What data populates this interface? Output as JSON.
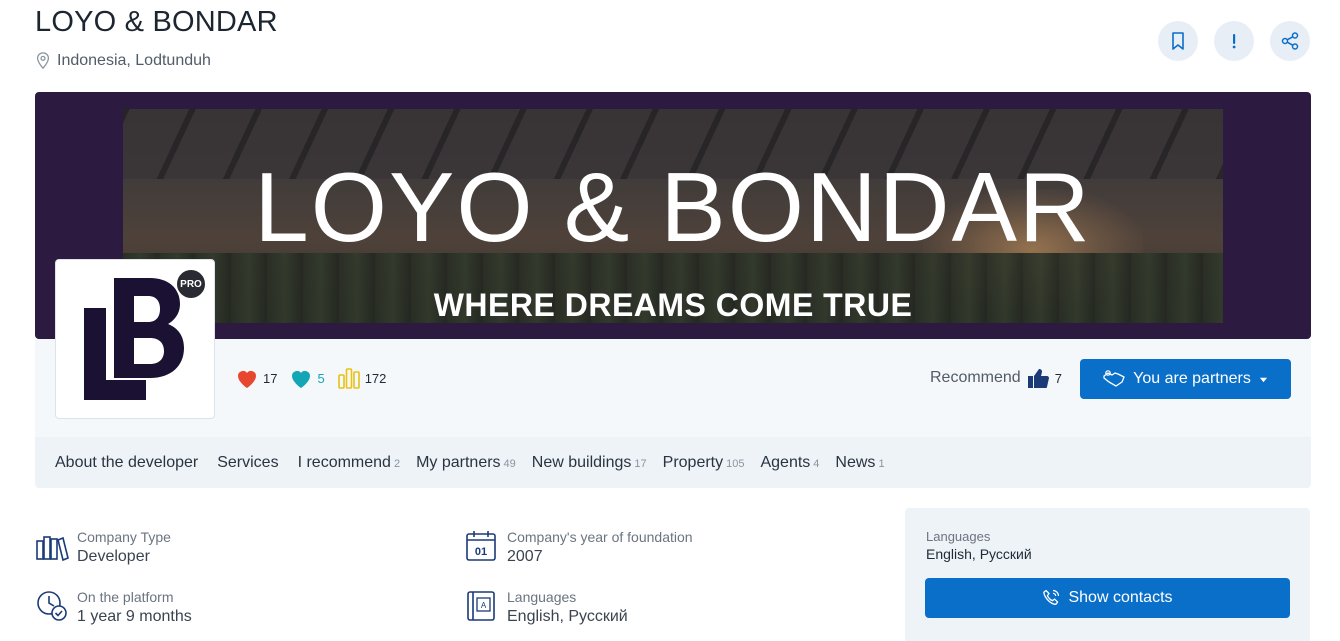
{
  "header": {
    "title": "LOYO & BONDAR",
    "location": "Indonesia, Lodtunduh"
  },
  "banner": {
    "title": "LOYO & BONDAR",
    "subtitle": "WHERE DREAMS COME TRUE"
  },
  "logo": {
    "badge": "PRO"
  },
  "stats": {
    "likes": "17",
    "favorites": "5",
    "views": "172"
  },
  "recommend": {
    "label": "Recommend",
    "count": "7"
  },
  "partners_button": "You are partners",
  "tabs": [
    {
      "label": "About the developer",
      "count": ""
    },
    {
      "label": "Services",
      "count": ""
    },
    {
      "label": "I recommend",
      "count": "2"
    },
    {
      "label": "My partners",
      "count": "49"
    },
    {
      "label": "New buildings",
      "count": "17"
    },
    {
      "label": "Property",
      "count": "105"
    },
    {
      "label": "Agents",
      "count": "4"
    },
    {
      "label": "News",
      "count": "1"
    }
  ],
  "info": {
    "company_type": {
      "label": "Company Type",
      "value": "Developer"
    },
    "foundation": {
      "label": "Company's year of foundation",
      "value": "2007"
    },
    "platform": {
      "label": "On the platform",
      "value": "1 year 9 months"
    },
    "languages": {
      "label": "Languages",
      "value": "English, Русский"
    }
  },
  "side_panel": {
    "languages_label": "Languages",
    "languages_value": "English, Русский",
    "contacts_button": "Show contacts"
  },
  "colors": {
    "accent": "#0a6fc9",
    "banner_bg": "#2d1a40",
    "heart": "#e8472f",
    "teal": "#15a6b5",
    "yellow": "#e8c215",
    "logo_dark": "#1b1233"
  }
}
